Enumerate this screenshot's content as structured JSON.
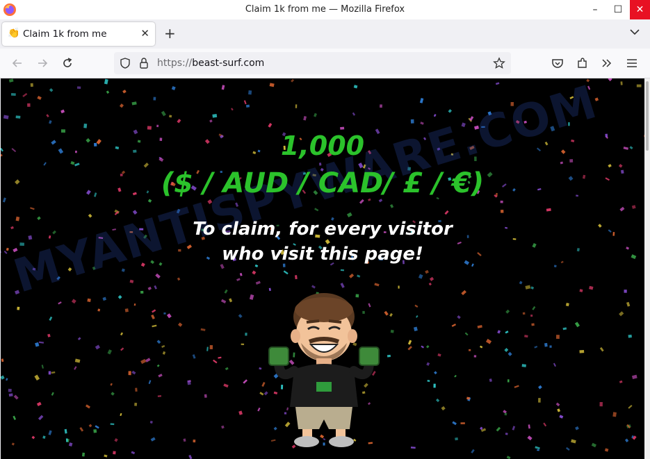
{
  "window": {
    "title": "Claim 1k from me — Mozilla Firefox",
    "minimize": "–",
    "maximize": "☐",
    "close": "✕"
  },
  "tab": {
    "favicon": "👏",
    "label": "Claim 1k from me",
    "close": "✕",
    "new_tab": "+"
  },
  "navbar": {
    "url_protocol": "https://",
    "url_host": "beast-surf.com"
  },
  "page": {
    "amount": "1,000",
    "currencies": "($ / AUD / CAD/ £ / €)",
    "line1": "To claim, for every visitor",
    "line2": "who visit this page!",
    "watermark": "MYANTISPYWARE.COM"
  },
  "colors": {
    "accent_green": "#2bc22b",
    "background": "#000000",
    "close_red": "#e81123"
  }
}
